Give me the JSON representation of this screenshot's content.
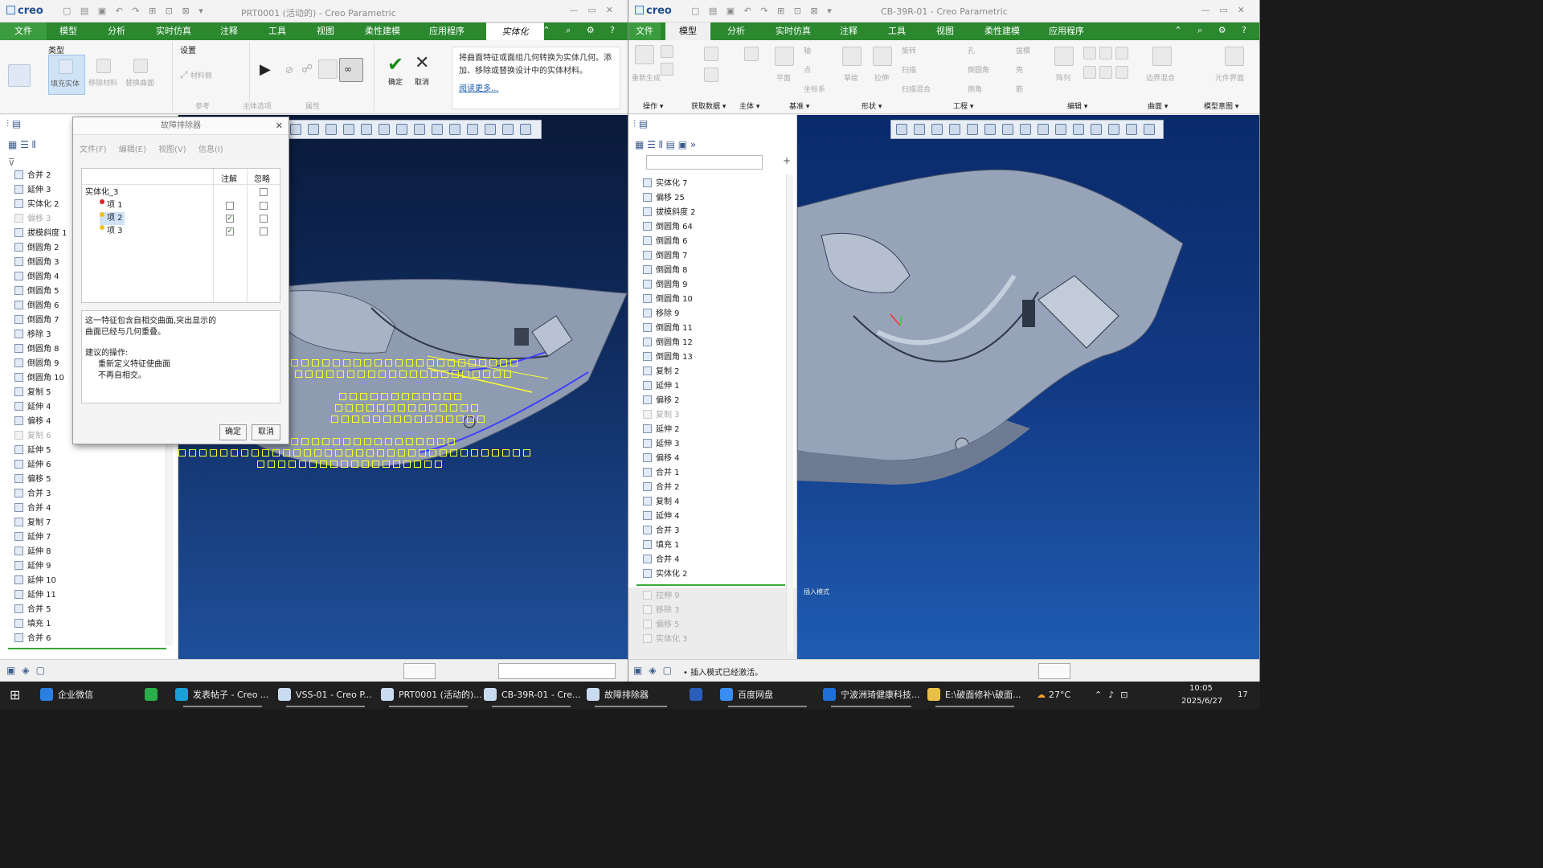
{
  "left_window": {
    "logo": "creo",
    "title": "PRT0001 (活动的) - Creo Parametric",
    "tabs": [
      "文件",
      "模型",
      "分析",
      "实时仿真",
      "注释",
      "工具",
      "视图",
      "柔性建模",
      "应用程序",
      "实体化"
    ],
    "ribbon": {
      "group_type": "类型",
      "group_settings": "设置",
      "btn_fill_solid": "填充实体",
      "btn_remove_material": "移除材料",
      "btn_replace_surface": "替换曲面",
      "btn_material_side": "材料侧",
      "btn_confirm": "确定",
      "btn_cancel": "取消",
      "foot_reference": "参考",
      "foot_body_options": "主体选项",
      "foot_properties": "属性",
      "info_text": "将曲面特征或面组几何转换为实体几何。添加、移除或替换设计中的实体材料。",
      "info_link": "阅读更多..."
    },
    "tree": [
      "合并 2",
      "延伸 3",
      "实体化 2",
      "偏移 3",
      "拔模斜度 1",
      "倒圆角 2",
      "倒圆角 3",
      "倒圆角 4",
      "倒圆角 5",
      "倒圆角 6",
      "倒圆角 7",
      "移除 3",
      "倒圆角 8",
      "倒圆角 9",
      "倒圆角 10",
      "复制 5",
      "延伸 4",
      "偏移 4",
      "复制 6",
      "延伸 5",
      "延伸 6",
      "偏移 5",
      "合并 3",
      "合并 4",
      "复制 7",
      "延伸 7",
      "延伸 8",
      "延伸 9",
      "延伸 10",
      "延伸 11",
      "合并 5",
      "填充 1",
      "合并 6"
    ],
    "tree_dim": [
      "偏移 3",
      "复制 6"
    ]
  },
  "dialog": {
    "title": "故障排除器",
    "menu": [
      "文件(F)",
      "编辑(E)",
      "视图(V)",
      "信息(I)"
    ],
    "col_note": "注解",
    "col_ignore": "忽略",
    "root": "实体化_3",
    "items": [
      {
        "label": "项 1",
        "dot": "#e02020",
        "note": false,
        "ignore": false
      },
      {
        "label": "项 2",
        "dot": "#f0c020",
        "note": true,
        "ignore": false
      },
      {
        "label": "项 3",
        "dot": "#f0c020",
        "note": true,
        "ignore": false
      }
    ],
    "message_line1": "这一特征包含自相交曲面,突出显示的",
    "message_line2": "曲面已经与几何重叠。",
    "message_line3": "建议的操作:",
    "message_line4": "重新定义特征使曲面",
    "message_line5": "不再自相交。",
    "btn_ok": "确定",
    "btn_cancel": "取消"
  },
  "right_window": {
    "logo": "creo",
    "title": "CB-39R-01 - Creo Parametric",
    "tabs": [
      "文件",
      "模型",
      "分析",
      "实时仿真",
      "注释",
      "工具",
      "视图",
      "柔性建模",
      "应用程序"
    ],
    "ribbon_groups": [
      "操作",
      "获取数据",
      "主体",
      "基准",
      "形状",
      "工程",
      "编辑",
      "曲面",
      "模型意图"
    ],
    "ribbon_labels": {
      "regen": "重新生成",
      "plane": "平面",
      "axis": "轴",
      "point": "点",
      "csys": "坐标系",
      "sketch": "草绘",
      "extrude": "拉伸",
      "revolve": "旋转",
      "sweep": "扫描",
      "swept_blend": "扫描混合",
      "hole": "孔",
      "round": "倒圆角",
      "chamfer": "倒角",
      "draft": "拔模",
      "shell": "壳",
      "rib": "筋",
      "pattern": "阵列",
      "boundary_blend": "边界混合",
      "component_interface": "元件界面"
    },
    "tree": [
      "实体化 7",
      "偏移 25",
      "拔模斜度 2",
      "倒圆角 64",
      "倒圆角 6",
      "倒圆角 7",
      "倒圆角 8",
      "倒圆角 9",
      "倒圆角 10",
      "移除 9",
      "倒圆角 11",
      "倒圆角 12",
      "倒圆角 13",
      "复制 2",
      "延伸 1",
      "偏移 2",
      "复制 3",
      "延伸 2",
      "延伸 3",
      "偏移 4",
      "合并 1",
      "合并 2",
      "复制 4",
      "延伸 4",
      "合并 3",
      "填充 1",
      "合并 4",
      "实体化 2"
    ],
    "tree_dim": [
      "复制 3"
    ],
    "tree_after_insert": [
      "拉伸 9",
      "移除 3",
      "偏移 5",
      "实体化 3"
    ],
    "viewport_label": "插入模式",
    "status": "插入模式已经激活。"
  },
  "taskbar": {
    "items": [
      "企业微信",
      "发表帖子 - Creo ...",
      "VSS-01 - Creo P...",
      "PRT0001 (活动的)...",
      "CB-39R-01 - Cre...",
      "故障排除器",
      "百度网盘",
      "宁波洲琦健康科技...",
      "E:\\破面修补\\破面..."
    ],
    "temperature": "27°C",
    "time": "10:05",
    "date": "2025/6/27",
    "notification_count": "17"
  },
  "colors": {
    "menubar_green": "#2b882f",
    "viewport_top": "#0a1a3a",
    "viewport_bottom": "#1f4f9a",
    "part_gray": "#8e9bb1",
    "highlight_yellow": "#ffff33"
  }
}
